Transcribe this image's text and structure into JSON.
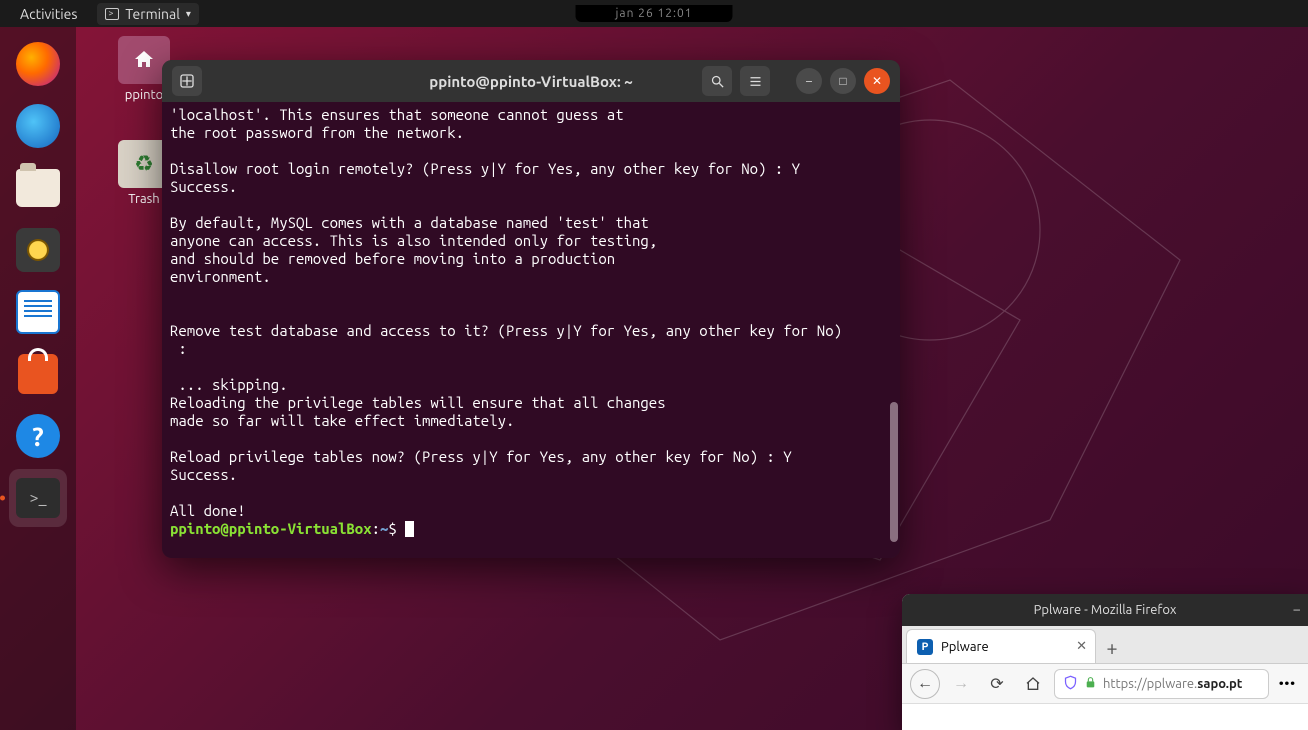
{
  "topbar": {
    "activities": "Activities",
    "app_label": "Terminal",
    "clock": "jan 26 12:01"
  },
  "desktop": {
    "home_label": "ppinto",
    "trash_label": "Trash"
  },
  "dock": {
    "items": [
      "firefox",
      "thunderbird",
      "files",
      "rhythmbox",
      "writer",
      "software",
      "help",
      "terminal"
    ]
  },
  "terminal": {
    "title": "ppinto@ppinto-VirtualBox: ~",
    "prompt_user": "ppinto@ppinto-VirtualBox",
    "prompt_colon": ":",
    "prompt_path": "~",
    "prompt_dollar": "$ ",
    "output": "'localhost'. This ensures that someone cannot guess at\nthe root password from the network.\n\nDisallow root login remotely? (Press y|Y for Yes, any other key for No) : Y\nSuccess.\n\nBy default, MySQL comes with a database named 'test' that\nanyone can access. This is also intended only for testing,\nand should be removed before moving into a production\nenvironment.\n\n\nRemove test database and access to it? (Press y|Y for Yes, any other key for No)\n :\n\n ... skipping.\nReloading the privilege tables will ensure that all changes\nmade so far will take effect immediately.\n\nReload privilege tables now? (Press y|Y for Yes, any other key for No) : Y\nSuccess.\n\nAll done!"
  },
  "firefox": {
    "window_title": "Pplware - Mozilla Firefox",
    "tab_label": "Pplware",
    "url_prefix": "https://pplware.",
    "url_bold": "sapo.pt"
  }
}
